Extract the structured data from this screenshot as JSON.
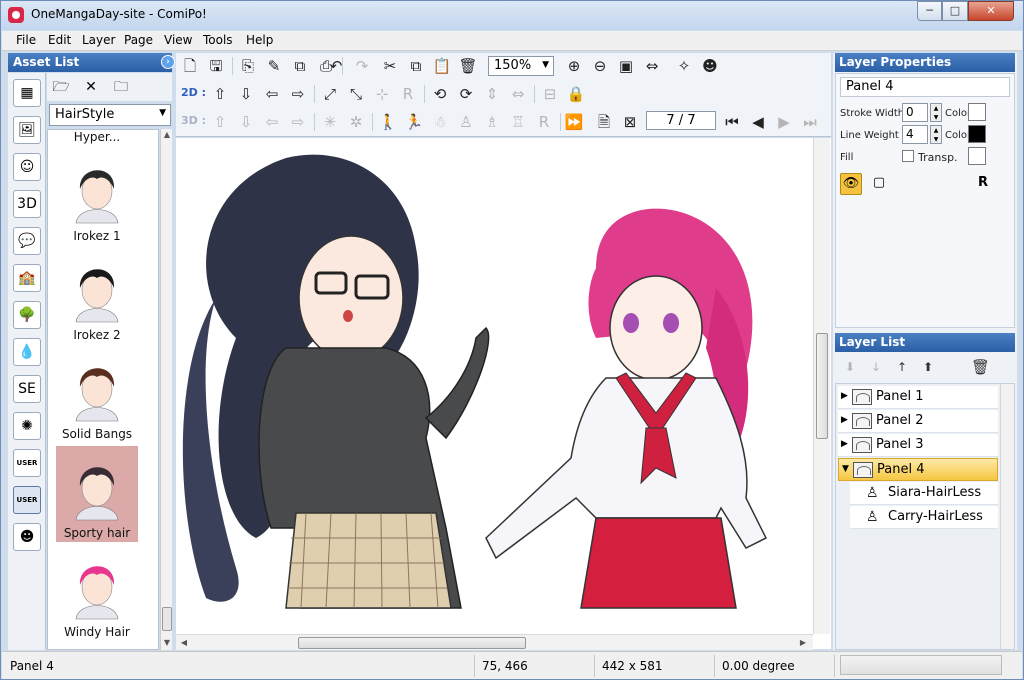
{
  "window": {
    "title": "OneMangaDay-site - ComiPo!",
    "minimize_label": "─",
    "maximize_label": "□",
    "close_label": "✕"
  },
  "menu": [
    "File",
    "Edit",
    "Layer",
    "Page",
    "View",
    "Tools",
    "Help"
  ],
  "asset_panel": {
    "title": "Asset List",
    "category": "HairStyle",
    "categories": [
      "panel-layout-icon",
      "background-icon",
      "character-icon",
      "3d-object-icon",
      "speech-balloon-icon",
      "background-scene-icon",
      "tree-icon",
      "drop-icon",
      "sound-effect-icon",
      "effect-burst-icon",
      "user-asset-icon",
      "user-3d-icon",
      "face-icon"
    ],
    "cat_glyphs": [
      "▦",
      "🖼",
      "☺",
      "3D",
      "💬",
      "🏫",
      "🌳",
      "💧",
      "SE",
      "✺",
      "USER",
      "USER",
      "☻"
    ],
    "items": [
      {
        "label": "Hyper...",
        "hair": "#6b3a2a"
      },
      {
        "label": "Irokez 1",
        "hair": "#2a2a2a"
      },
      {
        "label": "Irokez 2",
        "hair": "#1a1a1a"
      },
      {
        "label": "Solid Bangs",
        "hair": "#5a2e1d"
      },
      {
        "label": "Sporty hair",
        "hair": "#3a2c35"
      },
      {
        "label": "Windy Hair",
        "hair": "#e8358d"
      }
    ]
  },
  "toolbar": {
    "zoom": "150%",
    "row_2d_label": "2D :",
    "row_3d_label": "3D :",
    "page_counter": "7 / 7"
  },
  "layer_properties": {
    "title": "Layer Properties",
    "panel_name": "Panel 4",
    "stroke_width_label": "Stroke Width",
    "stroke_width": "0",
    "line_weight_label": "Line Weight",
    "line_weight": "4",
    "color_label": "Color",
    "fill_label": "Fill",
    "transp_label": "Transp.",
    "stroke_color": "#ffffff",
    "line_color": "#000000"
  },
  "layer_list": {
    "title": "Layer List",
    "layers": [
      {
        "name": "Panel 1",
        "selected": false,
        "child": false
      },
      {
        "name": "Panel 2",
        "selected": false,
        "child": false
      },
      {
        "name": "Panel 3",
        "selected": false,
        "child": false
      },
      {
        "name": "Panel 4",
        "selected": true,
        "child": false
      },
      {
        "name": "Siara-HairLess",
        "selected": false,
        "child": true
      },
      {
        "name": "Carry-HairLess",
        "selected": false,
        "child": true
      }
    ]
  },
  "status": {
    "layer": "Panel 4",
    "coords": "75, 466",
    "size": "442 x 581",
    "rotation": "0.00 degree"
  }
}
